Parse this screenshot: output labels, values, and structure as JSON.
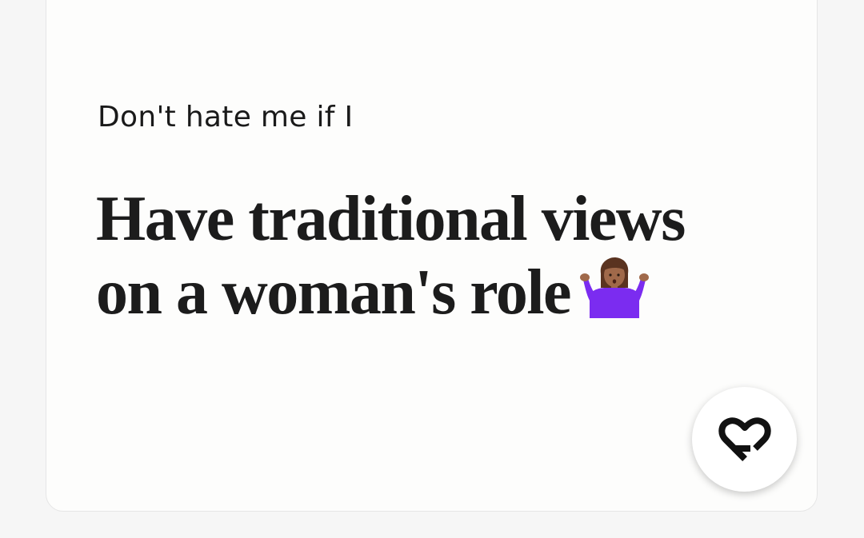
{
  "prompt": {
    "label": "Don't hate me if I",
    "answer": "Have traditional views on a woman's role"
  },
  "emoji": {
    "name": "person-shrugging-icon",
    "skin_color": "#a0694a",
    "shirt_color": "#7b2cf0",
    "hair_color": "#5a3320"
  },
  "like_button": {
    "icon": "heart-icon",
    "icon_color": "#111111"
  }
}
